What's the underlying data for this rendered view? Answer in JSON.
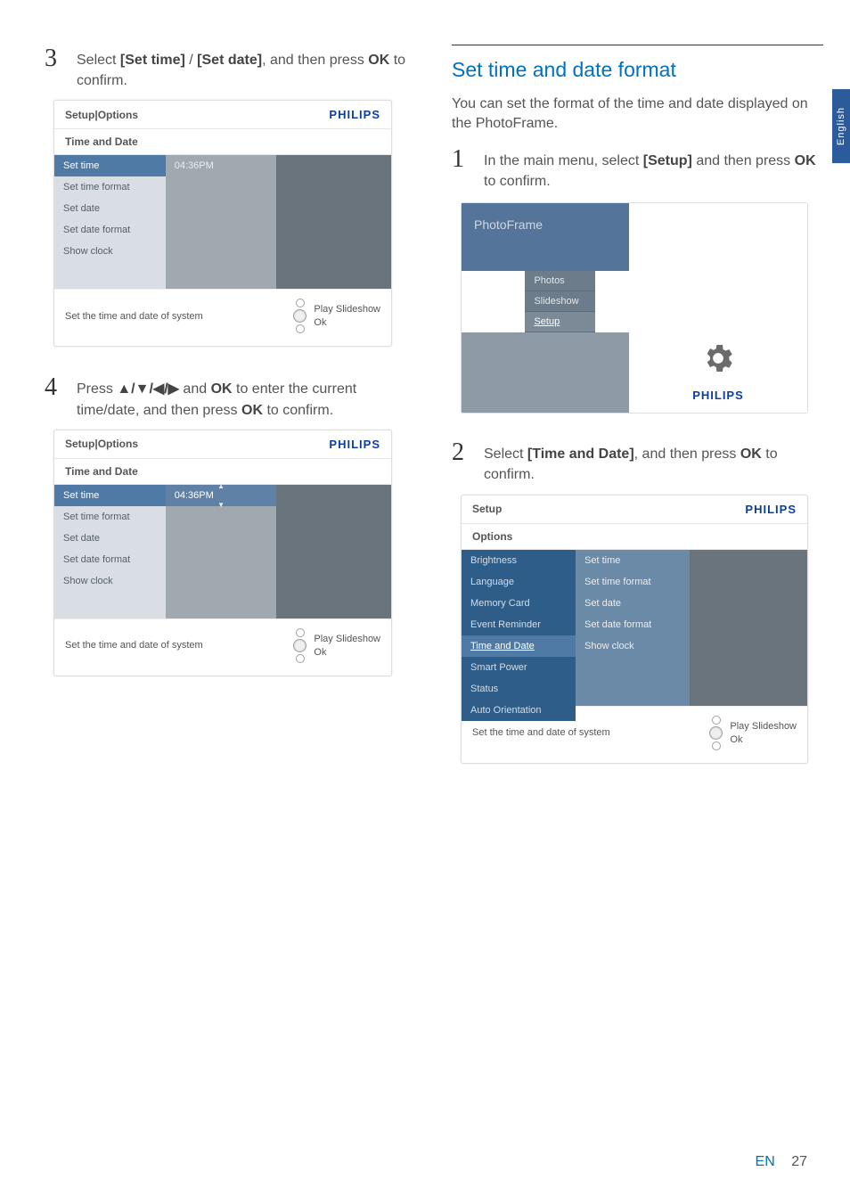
{
  "sidebar_tab": "English",
  "left": {
    "step3": {
      "num": "3",
      "pre": "Select ",
      "opt1": "[Set time]",
      "slash": " / ",
      "opt2": "[Set date]",
      "post1": ", and then press ",
      "ok": "OK",
      "post2": " to confirm."
    },
    "step4": {
      "num": "4",
      "pre": "Press ",
      "arrows": "▲/▼/◀/▶",
      "mid1": " and ",
      "ok1": "OK",
      "mid2": " to enter the current time/date, and then press ",
      "ok2": "OK",
      "post": " to confirm."
    },
    "ui_a": {
      "header": "Setup|Options",
      "brand": "PHILIPS",
      "subheader": "Time and Date",
      "items": [
        "Set time",
        "Set time format",
        "Set date",
        "Set date format",
        "Show clock"
      ],
      "value": "04:36PM",
      "footer_hint": "Set the time and date of system",
      "footer_play": "Play Slideshow",
      "footer_ok": "Ok"
    },
    "ui_b": {
      "header": "Setup|Options",
      "brand": "PHILIPS",
      "subheader": "Time and Date",
      "items": [
        "Set time",
        "Set time format",
        "Set date",
        "Set date format",
        "Show clock"
      ],
      "value": "04:36PM",
      "footer_hint": "Set the time and date of system",
      "footer_play": "Play Slideshow",
      "footer_ok": "Ok"
    }
  },
  "right": {
    "heading": "Set time and date format",
    "intro": "You can set the format of the time and date displayed on the PhotoFrame.",
    "step1": {
      "num": "1",
      "pre": "In the main menu, select ",
      "opt": "[Setup]",
      "mid": " and then press ",
      "ok": "OK",
      "post": " to confirm."
    },
    "pf": {
      "title": "PhotoFrame",
      "items": [
        "Photos",
        "Slideshow",
        "Setup"
      ],
      "brand": "PHILIPS"
    },
    "step2": {
      "num": "2",
      "pre": "Select ",
      "opt": "[Time and Date]",
      "mid": ", and then press ",
      "ok": "OK",
      "post": " to confirm."
    },
    "ui_c": {
      "header": "Setup",
      "brand": "PHILIPS",
      "subheader": "Options",
      "col1": [
        "Brightness",
        "Language",
        "Memory Card",
        "Event Reminder",
        "Time and Date",
        "Smart Power",
        "Status",
        "Auto Orientation"
      ],
      "col2": [
        "Set time",
        "Set time format",
        "Set date",
        "Set date format",
        "Show clock"
      ],
      "footer_hint": "Set the time and date of system",
      "footer_play": "Play Slideshow",
      "footer_ok": "Ok"
    }
  },
  "footer": {
    "lang": "EN",
    "page": "27"
  }
}
